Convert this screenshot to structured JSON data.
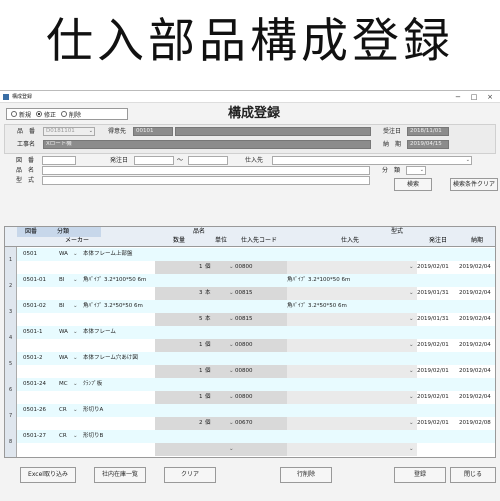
{
  "heading": "仕入部品構成登録",
  "window": {
    "title": "構成登録",
    "controls": {
      "minimize": "−",
      "maximize": "□",
      "close": "×"
    }
  },
  "mode": {
    "options": [
      {
        "label": "新規",
        "selected": false
      },
      {
        "label": "修正",
        "selected": true
      },
      {
        "label": "削除",
        "selected": false
      }
    ]
  },
  "form_title": "構成登録",
  "order": {
    "part_no_label": "品　番",
    "part_no": "D0181101",
    "shipto_label": "得意先",
    "shipto_code": "00101",
    "order_date_label": "受注日",
    "order_date": "2018/11/01",
    "work_label": "工事名",
    "work_name": "Xロート機",
    "delivery_label": "納　期",
    "delivery": "2019/04/15"
  },
  "search": {
    "drawing_label": "図　番",
    "order_date_label": "発注日",
    "range_sep": "～",
    "supplier_label": "仕入先",
    "name_label": "品　名",
    "type_label": "型　式",
    "class_label": "分　類",
    "search_button": "検索",
    "clear_conditions_button": "検索条件クリア"
  },
  "grid": {
    "headers": {
      "drawing": "図番",
      "class": "分類",
      "name": "品名",
      "maker": "メーカー",
      "qty": "数量",
      "unit": "単位",
      "supplier_code": "仕入先コード",
      "type": "型式",
      "supplier": "仕入先",
      "order_date": "発注日",
      "due": "納期"
    },
    "rows": [
      {
        "num": "1",
        "drawing": "0501",
        "class": "WA",
        "name": "本体フレーム上部盤",
        "qty": "1",
        "unit": "個",
        "supplier_code": "00800",
        "type": "",
        "supplier": "",
        "order_date": "2019/02/01",
        "due": "2019/02/04"
      },
      {
        "num": "2",
        "drawing": "0501-01",
        "class": "BI",
        "name": "角ﾊﾟｲﾌﾟ 3.2*100*50 6m",
        "qty": "3",
        "unit": "本",
        "supplier_code": "00815",
        "type": "角ﾊﾟｲﾌﾟ 3.2*100*50 6m",
        "supplier": "",
        "order_date": "2019/01/31",
        "due": "2019/02/04"
      },
      {
        "num": "3",
        "drawing": "0501-02",
        "class": "BI",
        "name": "角ﾊﾟｲﾌﾟ 3.2*50*50 6m",
        "qty": "5",
        "unit": "本",
        "supplier_code": "00815",
        "type": "角ﾊﾟｲﾌﾟ 3.2*50*50 6m",
        "supplier": "",
        "order_date": "2019/01/31",
        "due": "2019/02/04"
      },
      {
        "num": "4",
        "drawing": "0501-1",
        "class": "WA",
        "name": "本体フレーム",
        "qty": "1",
        "unit": "個",
        "supplier_code": "00800",
        "type": "",
        "supplier": "",
        "order_date": "2019/02/01",
        "due": "2019/02/04"
      },
      {
        "num": "5",
        "drawing": "0501-2",
        "class": "WA",
        "name": "本体フレーム穴あけ図",
        "qty": "1",
        "unit": "個",
        "supplier_code": "00800",
        "type": "",
        "supplier": "",
        "order_date": "2019/02/01",
        "due": "2019/02/04"
      },
      {
        "num": "6",
        "drawing": "0501-24",
        "class": "MC",
        "name": "ｸﾗﾝﾌﾟ板",
        "qty": "1",
        "unit": "個",
        "supplier_code": "00800",
        "type": "",
        "supplier": "",
        "order_date": "2019/02/01",
        "due": "2019/02/04"
      },
      {
        "num": "7",
        "drawing": "0501-26",
        "class": "CR",
        "name": "形切りA",
        "qty": "2",
        "unit": "個",
        "supplier_code": "00670",
        "type": "",
        "supplier": "",
        "order_date": "2019/02/01",
        "due": "2019/02/08"
      },
      {
        "num": "8",
        "drawing": "0501-27",
        "class": "CR",
        "name": "形切りB",
        "qty": "",
        "unit": "",
        "supplier_code": "",
        "type": "",
        "supplier": "",
        "order_date": "",
        "due": ""
      }
    ]
  },
  "buttons": {
    "excel": "Excel取り込み",
    "stock": "社内在庫一覧",
    "clear": "クリア",
    "delete_row": "行削除",
    "register": "登録",
    "close": "閉じる"
  }
}
